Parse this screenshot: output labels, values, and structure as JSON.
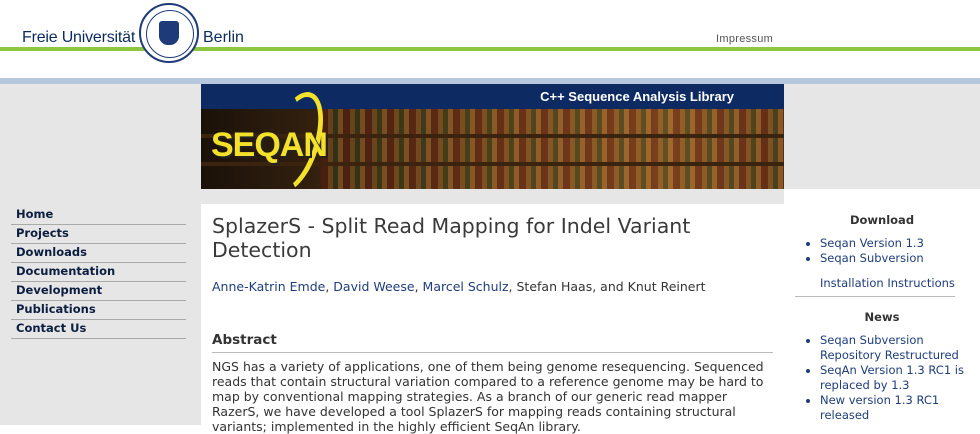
{
  "header": {
    "university_left": "Freie Universität",
    "university_right": "Berlin",
    "impressum": "Impressum"
  },
  "banner": {
    "subtitle": "C++ Sequence Analysis Library",
    "logo_text": "SEQAN"
  },
  "nav": {
    "items": [
      {
        "label": "Home"
      },
      {
        "label": "Projects"
      },
      {
        "label": "Downloads"
      },
      {
        "label": "Documentation"
      },
      {
        "label": "Development"
      },
      {
        "label": "Publications"
      },
      {
        "label": "Contact Us"
      }
    ]
  },
  "main": {
    "title": "SplazerS - Split Read Mapping for Indel Variant Detection",
    "authors": {
      "linked": [
        "Anne-Katrin Emde",
        "David Weese",
        "Marcel Schulz"
      ],
      "plain": [
        "Stefan Haas",
        "Knut Reinert"
      ]
    },
    "abstract_heading": "Abstract",
    "abstract_text": "NGS has a variety of applications, one of them being genome resequencing. Sequenced reads that contain structural variation compared to a reference genome may be hard to map by conventional mapping strategies. As a branch of our generic read mapper RazerS, we have developed a tool SplazerS for mapping reads containing structural variants; implemented in the highly efficient SeqAn library."
  },
  "sidebar": {
    "download_heading": "Download",
    "download_items": [
      {
        "label": "Seqan Version 1.3"
      },
      {
        "label": "Seqan Subversion"
      }
    ],
    "installation_link": "Installation Instructions",
    "news_heading": "News",
    "news_items": [
      {
        "label": "Seqan Subversion Repository Restructured"
      },
      {
        "label": "SeqAn Version 1.3 RC1 is replaced by 1.3"
      },
      {
        "label": "New version 1.3 RC1 released"
      }
    ]
  },
  "colors": {
    "navy": "#0d2a63",
    "green_line": "#8dc63f",
    "blue_line": "#b7c7de",
    "link": "#1f3d7a",
    "logo_yellow": "#f4e22a"
  }
}
